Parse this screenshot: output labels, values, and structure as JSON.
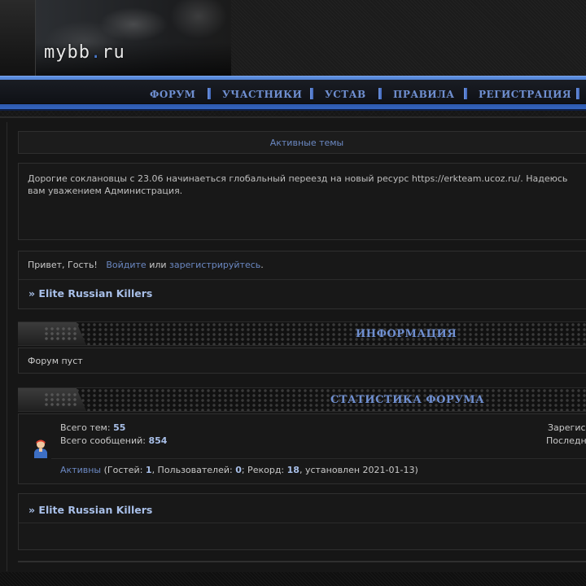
{
  "header": {
    "logo_main": "mybb",
    "logo_dot": ".",
    "logo_tld": "ru"
  },
  "nav": {
    "items": [
      {
        "label": "ФОРУМ"
      },
      {
        "label": "УЧАСТНИКИ"
      },
      {
        "label": "УСТАВ"
      },
      {
        "label": "ПРАВИЛА"
      },
      {
        "label": "РЕГИСТРАЦИЯ"
      }
    ]
  },
  "active_topics": "Активные темы",
  "announcement": "Дорогие сокланowцы с 23.06 начинаеться глобальный переезд на новый ресурс https://erkteam.ucoz.ru/. Надеюсь вам уважением Администрация.",
  "welcome": {
    "greeting": "Привет, Гость!",
    "login": "Войдите",
    "or": "или",
    "register": "зарегистрируйтесь",
    "period": ".",
    "forum_title": "» Elite Russian Killers"
  },
  "info": {
    "title": "ИНФОРМАЦИЯ",
    "body": "Форум пуст"
  },
  "stats": {
    "title": "СТАТИСТИКА ФОРУМА",
    "topics_label": "Всего тем:",
    "topics_value": "55",
    "posts_label": "Всего сообщений:",
    "posts_value": "854",
    "right_line1": "Зарегис",
    "right_line2": "Последн",
    "active_label": "Активны",
    "guests_label": "(Гостей:",
    "guests_value": "1",
    "users_label": ", Пользователей:",
    "users_value": "0",
    "record_label": "; Рекорд:",
    "record_value": "18",
    "record_date": ", установлен 2021-01-13)"
  },
  "bottom_forum_title": "» Elite Russian Killers",
  "colors": {
    "accent": "#6b88c2",
    "nav_blue": "#2f5bb3",
    "bold_value": "#a8bfe8"
  },
  "icons": {
    "user": "user-avatar-icon",
    "nav_separator": "nav-separator-icon"
  }
}
